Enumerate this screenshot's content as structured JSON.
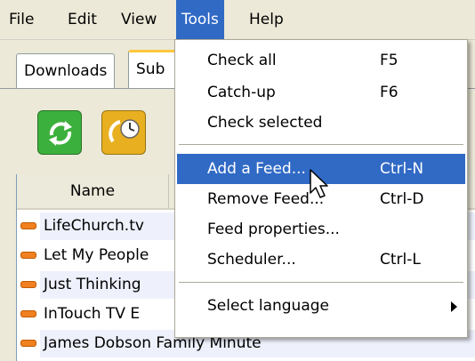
{
  "menubar": {
    "items": [
      {
        "label": "File"
      },
      {
        "label": "Edit"
      },
      {
        "label": "View"
      },
      {
        "label": "Tools"
      },
      {
        "label": "Help"
      }
    ]
  },
  "tabs": [
    {
      "label": "Downloads"
    },
    {
      "label": "Sub"
    }
  ],
  "list": {
    "header": {
      "name": "Name"
    },
    "rows": [
      {
        "name": "LifeChurch.tv"
      },
      {
        "name": "Let My People"
      },
      {
        "name": "Just Thinking"
      },
      {
        "name": "InTouch TV E"
      },
      {
        "name": "James Dobson Family Minute"
      }
    ]
  },
  "tools_menu": {
    "items": [
      {
        "label": "Check all",
        "shortcut": "F5"
      },
      {
        "label": "Catch-up",
        "shortcut": "F6"
      },
      {
        "label": "Check selected",
        "shortcut": ""
      },
      {
        "label": "Add a Feed...",
        "shortcut": "Ctrl-N"
      },
      {
        "label": "Remove Feed...",
        "shortcut": "Ctrl-D"
      },
      {
        "label": "Feed properties...",
        "shortcut": ""
      },
      {
        "label": "Scheduler...",
        "shortcut": "Ctrl-L"
      },
      {
        "label": "Select language",
        "shortcut": ""
      }
    ]
  },
  "colors": {
    "selection": "#316ac5",
    "feed_icon": "#f08020"
  }
}
